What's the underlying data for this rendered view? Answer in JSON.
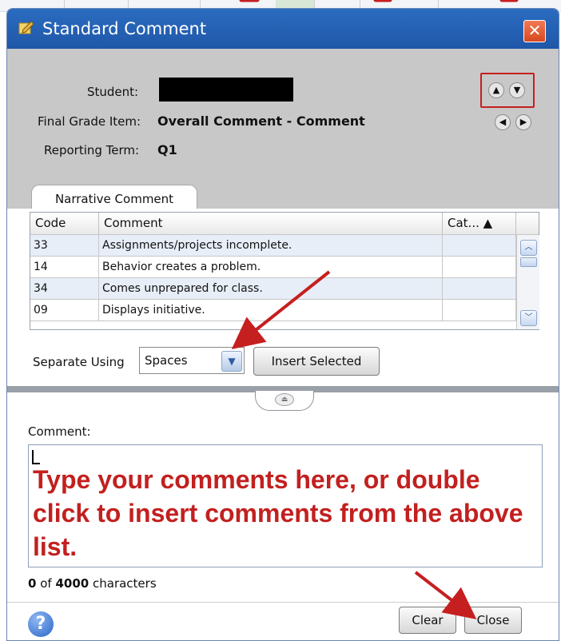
{
  "dialog": {
    "title": "Standard Comment",
    "title_icon": "pencil-note-icon",
    "close_icon": "close-x-icon"
  },
  "header": {
    "student_label": "Student:",
    "final_grade_label": "Final Grade Item:",
    "final_grade_value": "Overall Comment - Comment",
    "reporting_term_label": "Reporting Term:",
    "reporting_term_value": "Q1",
    "nav_up_icon": "triangle-up-icon",
    "nav_down_icon": "triangle-down-icon",
    "nav_left_icon": "triangle-left-icon",
    "nav_right_icon": "triangle-right-icon"
  },
  "tabs": [
    {
      "label": "Narrative Comment"
    }
  ],
  "table": {
    "columns": [
      "Code",
      "Comment",
      "Cat... ▲"
    ],
    "rows": [
      {
        "code": "33",
        "comment": "Assignments/projects incomplete.",
        "cat": ""
      },
      {
        "code": "14",
        "comment": "Behavior creates a problem.",
        "cat": ""
      },
      {
        "code": "34",
        "comment": "Comes unprepared for class.",
        "cat": ""
      },
      {
        "code": "09",
        "comment": "Displays initiative.",
        "cat": ""
      }
    ]
  },
  "separate": {
    "label": "Separate Using",
    "selected": "Spaces",
    "insert_label": "Insert Selected"
  },
  "comment": {
    "label": "Comment:",
    "placeholder": "Type your comments here, or double click to insert comments from the above list.",
    "count": "0",
    "count_of": "of",
    "max": "4000",
    "count_suffix": "characters"
  },
  "footer": {
    "help_icon": "help-question-icon",
    "clear_label": "Clear",
    "close_label": "Close"
  },
  "colors": {
    "titlebar": "#2b6cc0",
    "header_bg": "#c8c8c8",
    "annotation_red": "#c61f1f",
    "placeholder_red": "#c2201f"
  }
}
